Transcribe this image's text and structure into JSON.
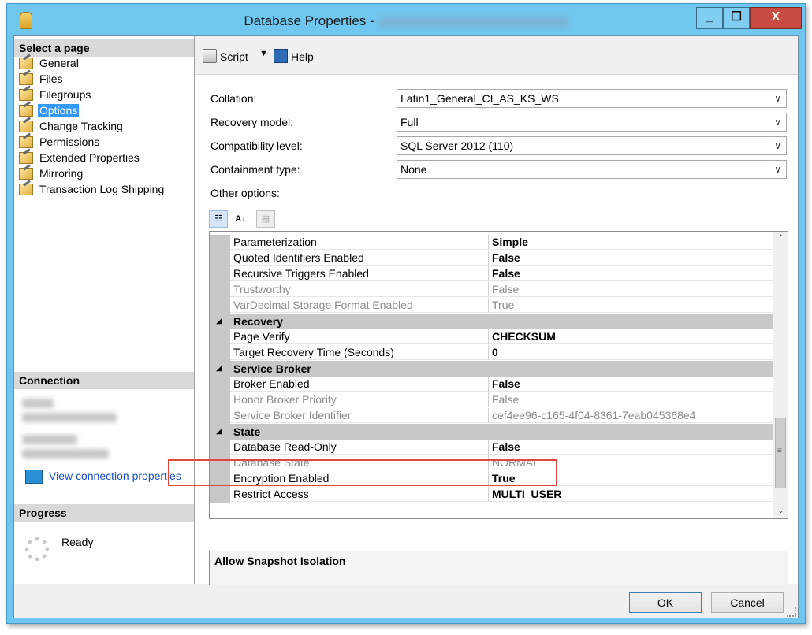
{
  "window": {
    "title": "Database Properties -",
    "min_label": "_",
    "max_label": "☐",
    "close_label": "X"
  },
  "left": {
    "select_page_header": "Select a page",
    "pages": [
      {
        "label": "General"
      },
      {
        "label": "Files"
      },
      {
        "label": "Filegroups"
      },
      {
        "label": "Options",
        "selected": true
      },
      {
        "label": "Change Tracking"
      },
      {
        "label": "Permissions"
      },
      {
        "label": "Extended Properties"
      },
      {
        "label": "Mirroring"
      },
      {
        "label": "Transaction Log Shipping"
      }
    ],
    "connection_header": "Connection",
    "view_connection_properties": "View connection properties",
    "progress_header": "Progress",
    "progress_status": "Ready"
  },
  "toolbar": {
    "script_label": "Script",
    "help_label": "Help"
  },
  "form": {
    "collation_label": "Collation:",
    "collation_value": "Latin1_General_CI_AS_KS_WS",
    "recovery_label": "Recovery model:",
    "recovery_value": "Full",
    "compat_label": "Compatibility level:",
    "compat_value": "SQL Server 2012 (110)",
    "containment_label": "Containment type:",
    "containment_value": "None",
    "other_options_label": "Other options:"
  },
  "grid": {
    "rows": [
      {
        "type": "prop",
        "name": "Parameterization",
        "value": "Simple"
      },
      {
        "type": "prop",
        "name": "Quoted Identifiers Enabled",
        "value": "False"
      },
      {
        "type": "prop",
        "name": "Recursive Triggers Enabled",
        "value": "False"
      },
      {
        "type": "prop",
        "name": "Trustworthy",
        "value": "False",
        "disabled": true
      },
      {
        "type": "prop",
        "name": "VarDecimal Storage Format Enabled",
        "value": "True",
        "disabled": true
      },
      {
        "type": "cat",
        "name": "Recovery"
      },
      {
        "type": "prop",
        "name": "Page Verify",
        "value": "CHECKSUM"
      },
      {
        "type": "prop",
        "name": "Target Recovery Time (Seconds)",
        "value": "0"
      },
      {
        "type": "cat",
        "name": "Service Broker"
      },
      {
        "type": "prop",
        "name": "Broker Enabled",
        "value": "False"
      },
      {
        "type": "prop",
        "name": "Honor Broker Priority",
        "value": "False",
        "disabled": true
      },
      {
        "type": "prop",
        "name": "Service Broker Identifier",
        "value": "cef4ee96-c165-4f04-8361-7eab045368e4",
        "disabled": true
      },
      {
        "type": "cat",
        "name": "State"
      },
      {
        "type": "prop",
        "name": "Database Read-Only",
        "value": "False"
      },
      {
        "type": "prop",
        "name": "Database State",
        "value": "NORMAL",
        "disabled": true
      },
      {
        "type": "prop",
        "name": "Encryption Enabled",
        "value": "True"
      },
      {
        "type": "prop",
        "name": "Restrict Access",
        "value": "MULTI_USER"
      }
    ],
    "collapse_glyph": "◢",
    "scroll_up": "⌃",
    "scroll_down": "⌄",
    "scroll_grip": "≡"
  },
  "description": {
    "title": "Allow Snapshot Isolation"
  },
  "footer": {
    "ok_label": "OK",
    "cancel_label": "Cancel"
  },
  "colors": {
    "accent": "#3399ff",
    "highlight": "#e0473e",
    "titlebar": "#6fc6ee",
    "close": "#c74b43"
  }
}
